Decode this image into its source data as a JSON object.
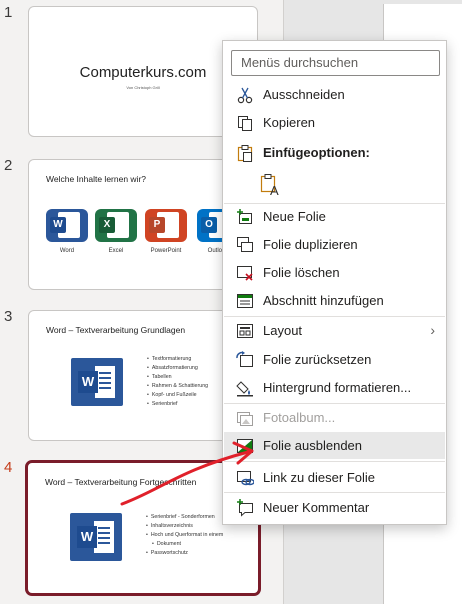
{
  "slides": [
    {
      "number": "1",
      "title": "Computerkurs.com",
      "subtitle": "Von Christoph Grill"
    },
    {
      "number": "2",
      "title": "Welche Inhalte lernen wir?",
      "apps": [
        {
          "name": "Word",
          "letter": "W",
          "color": "#2b579a"
        },
        {
          "name": "Excel",
          "letter": "X",
          "color": "#217346"
        },
        {
          "name": "PowerPoint",
          "letter": "P",
          "color": "#d04423"
        },
        {
          "name": "Outlook",
          "letter": "O",
          "color": "#0072c6"
        }
      ]
    },
    {
      "number": "3",
      "title": "Word – Textverarbeitung Grundlagen",
      "bullets": [
        "Textformatierung",
        "Absatzformatierung",
        "Tabellen",
        "Rahmen & Schattierung",
        "Kopf- und Fußzeile",
        "Serienbrief"
      ]
    },
    {
      "number": "4",
      "title": "Word – Textverarbeitung Fortgeschritten",
      "bullets": [
        "Serienbrief - Sonderformen",
        "Inhaltsverzeichnis",
        "Hoch und Querformat in einem",
        "Dokument",
        "Passwortschutz"
      ]
    }
  ],
  "context_menu": {
    "search_placeholder": "Menüs durchsuchen",
    "items": {
      "cut": "Ausschneiden",
      "copy": "Kopieren",
      "paste_options": "Einfügeoptionen:",
      "new_slide": "Neue Folie",
      "duplicate": "Folie duplizieren",
      "delete": "Folie löschen",
      "add_section": "Abschnitt hinzufügen",
      "layout": "Layout",
      "reset": "Folie zurücksetzen",
      "format_bg": "Hintergrund formatieren...",
      "photo_album": "Fotoalbum...",
      "hide_slide": "Folie ausblenden",
      "link": "Link zu dieser Folie",
      "new_comment": "Neuer Kommentar"
    }
  },
  "colors": {
    "accent": "#c43e1c",
    "selected_border": "#7a1c2a",
    "highlight": "#fff200",
    "annotation_arrow": "#e0202a"
  }
}
